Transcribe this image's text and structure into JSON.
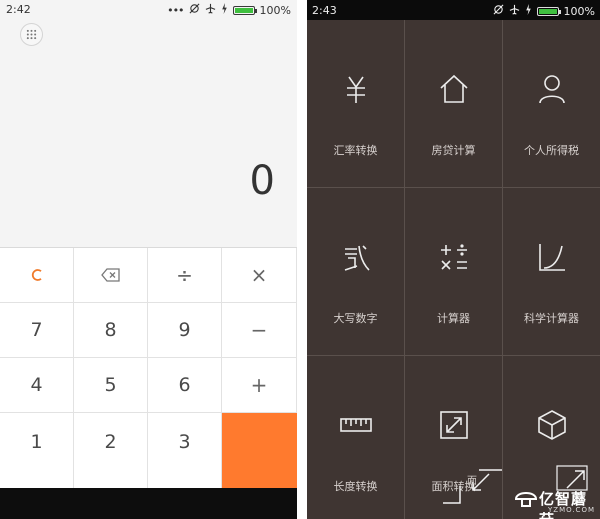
{
  "left_phone": {
    "status": {
      "time": "2:42",
      "battery": "100%"
    },
    "display_value": "0",
    "keys": [
      {
        "label": "C",
        "type": "clear"
      },
      {
        "label": "⌫",
        "type": "op",
        "icon": "backspace-icon"
      },
      {
        "label": "÷",
        "type": "op"
      },
      {
        "label": "×",
        "type": "op"
      },
      {
        "label": "7",
        "type": "digit"
      },
      {
        "label": "8",
        "type": "digit"
      },
      {
        "label": "9",
        "type": "digit"
      },
      {
        "label": "−",
        "type": "op"
      },
      {
        "label": "4",
        "type": "digit"
      },
      {
        "label": "5",
        "type": "digit"
      },
      {
        "label": "6",
        "type": "digit"
      },
      {
        "label": "+",
        "type": "op"
      },
      {
        "label": "1",
        "type": "digit"
      },
      {
        "label": "2",
        "type": "digit"
      },
      {
        "label": "3",
        "type": "digit"
      }
    ]
  },
  "right_phone": {
    "status": {
      "time": "2:43",
      "battery": "100%"
    },
    "tools": [
      {
        "label": "汇率转换",
        "icon": "yen-icon"
      },
      {
        "label": "房贷计算",
        "icon": "house-icon"
      },
      {
        "label": "个人所得税",
        "icon": "person-icon"
      },
      {
        "label": "大写数字",
        "icon": "chinese-numeral-icon"
      },
      {
        "label": "计算器",
        "icon": "calculator-icon"
      },
      {
        "label": "科学计算器",
        "icon": "graph-icon"
      },
      {
        "label": "长度转换",
        "icon": "ruler-icon"
      },
      {
        "label": "面积转换",
        "icon": "area-icon"
      },
      {
        "label": "",
        "icon": "cube-icon"
      }
    ],
    "overlay_caption": "面",
    "watermark": {
      "brand": "亿智蘑菇",
      "domain": "YZMO.COM"
    }
  },
  "colors": {
    "accent_orange": "#ff7a2e",
    "clear_orange": "#f07a2a",
    "tile_bg": "#3f3532"
  }
}
